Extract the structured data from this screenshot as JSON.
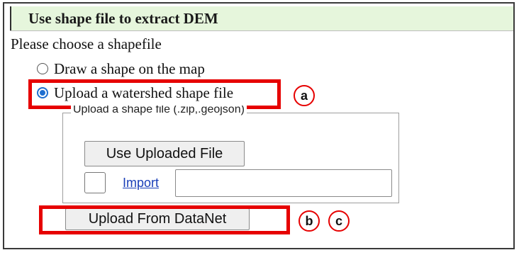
{
  "header": {
    "title": "Use shape file to extract DEM"
  },
  "prompt": "Please choose a shapefile",
  "options": [
    {
      "label": "Draw a shape on the map",
      "selected": false
    },
    {
      "label": "Upload a watershed shape file",
      "selected": true
    }
  ],
  "upload_group": {
    "legend": "Upload a shape file (.zip,.geojson)",
    "use_uploaded_button": "Use Uploaded File",
    "import_link": "Import",
    "file_value": ""
  },
  "datanet_button": "Upload From DataNet",
  "annotations": {
    "a": "a",
    "b": "b",
    "c": "c",
    "highlight_color": "#e60000"
  }
}
